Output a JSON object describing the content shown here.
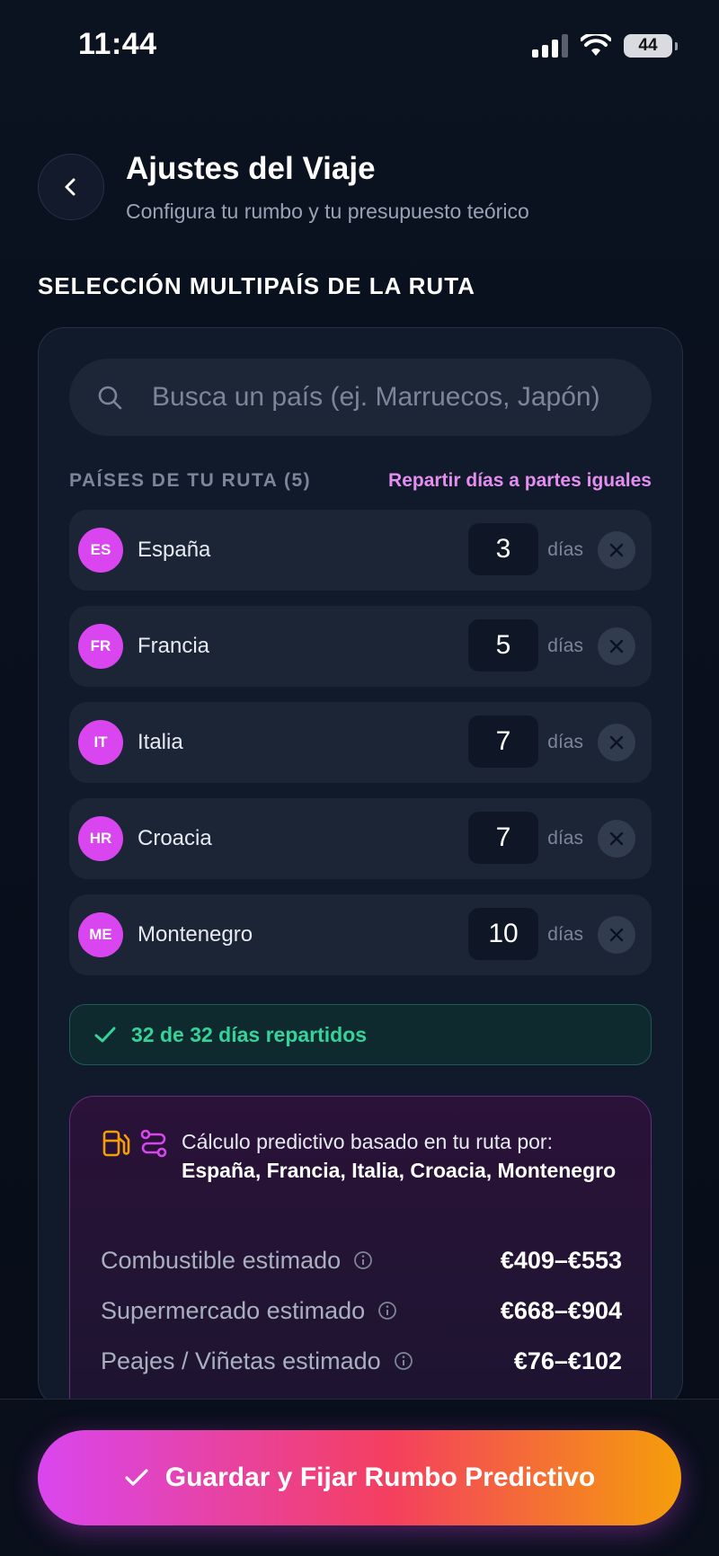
{
  "status_bar": {
    "time": "11:44",
    "battery": "44"
  },
  "header": {
    "title": "Ajustes del Viaje",
    "subtitle": "Configura tu rumbo y tu presupuesto teórico"
  },
  "section": {
    "title": "SELECCIÓN MULTIPAÍS DE LA RUTA"
  },
  "search": {
    "placeholder": "Busca un país (ej. Marruecos, Japón)"
  },
  "countries_header": {
    "label": "PAÍSES DE TU RUTA (5)",
    "split_link": "Repartir días a partes iguales"
  },
  "countries": [
    {
      "code": "ES",
      "name": "España",
      "days": "3",
      "unit": "días"
    },
    {
      "code": "FR",
      "name": "Francia",
      "days": "5",
      "unit": "días"
    },
    {
      "code": "IT",
      "name": "Italia",
      "days": "7",
      "unit": "días"
    },
    {
      "code": "HR",
      "name": "Croacia",
      "days": "7",
      "unit": "días"
    },
    {
      "code": "ME",
      "name": "Montenegro",
      "days": "10",
      "unit": "días"
    }
  ],
  "summary": {
    "text": "32 de 32 días repartidos"
  },
  "prediction": {
    "intro": "Cálculo predictivo basado en tu ruta por:",
    "countries_list": "España, Francia, Italia, Croacia, Montenegro",
    "costs": [
      {
        "label": "Combustible estimado",
        "value": "€409–€553"
      },
      {
        "label": "Supermercado estimado",
        "value": "€668–€904"
      },
      {
        "label": "Peajes / Viñetas estimado",
        "value": "€76–€102"
      }
    ]
  },
  "primary_action": {
    "label": "Guardar y Fijar Rumbo Predictivo"
  },
  "colors": {
    "accent": "#d946ef",
    "success": "#34d399",
    "gradient_end": "#f59e0b"
  }
}
